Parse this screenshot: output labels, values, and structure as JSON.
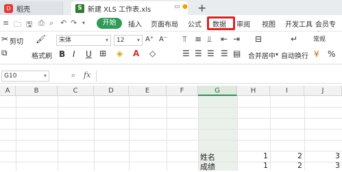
{
  "tabs": {
    "home": "稻壳",
    "doc": "新建 XLS 工作表.xls",
    "plus": "+"
  },
  "menu": {
    "start": "开始",
    "items": [
      "插入",
      "页面布局",
      "公式",
      "数据",
      "审阅",
      "视图",
      "开发工具",
      "会员专享"
    ]
  },
  "ribbon": {
    "cut": "剪切",
    "format_painter": "格式刷",
    "font": "宋体",
    "font_size": "12",
    "bold": "B",
    "italic": "I",
    "underline": "U",
    "merge": "合并居中",
    "wrap": "自动换行",
    "number_format": "常规",
    "font_color_letter": "A",
    "grow_font": "A⁺",
    "shrink_font": "A⁻"
  },
  "formula_bar": {
    "name_box": "G10",
    "fx": "fx",
    "value": ""
  },
  "columns": [
    "A",
    "B",
    "C",
    "D",
    "E",
    "F",
    "G",
    "H",
    "I",
    "J"
  ],
  "selected_column": "G",
  "rows": [
    {
      "label": "姓名",
      "values": [
        "1",
        "2",
        "3"
      ]
    },
    {
      "label": "成绩",
      "values": [
        "1",
        "2",
        "3"
      ]
    }
  ]
}
